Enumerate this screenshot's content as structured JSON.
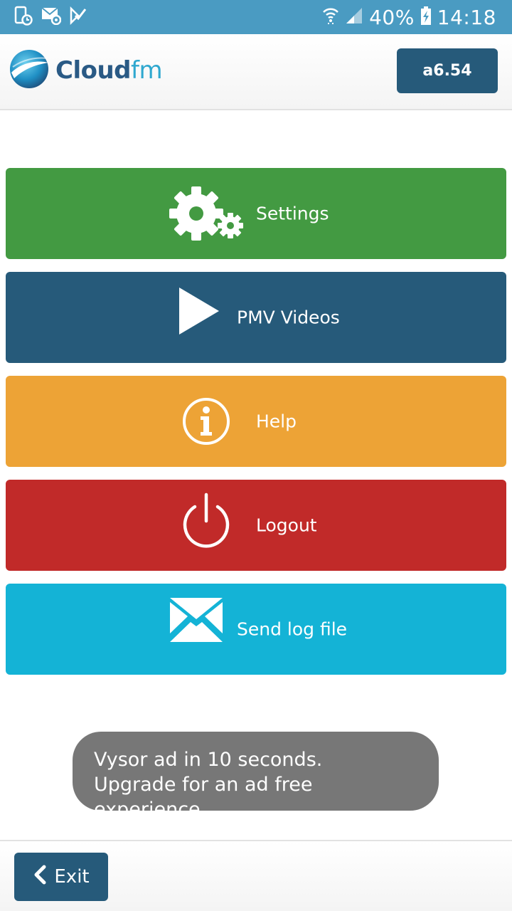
{
  "status_bar": {
    "battery": "40%",
    "time": "14:18",
    "icons": [
      "device-clock-icon",
      "mail-settings-icon",
      "checkmark-app-icon",
      "wifi-icon",
      "signal-icon",
      "battery-charging-icon"
    ]
  },
  "header": {
    "logo_cloud": "Cloud",
    "logo_fm": "fm",
    "version": "a6.54"
  },
  "menu": {
    "items": [
      {
        "label": "Settings",
        "icon": "gears-icon",
        "color": "#439a42"
      },
      {
        "label": "PMV Videos",
        "icon": "play-icon",
        "color": "#265a7a"
      },
      {
        "label": "Help",
        "icon": "info-icon",
        "color": "#eda336"
      },
      {
        "label": "Logout",
        "icon": "power-icon",
        "color": "#c12a29"
      },
      {
        "label": "Send log file",
        "icon": "envelope-icon",
        "color": "#14b3d6"
      }
    ]
  },
  "toast": {
    "line1": "Vysor ad in 10 seconds.",
    "line2": "Upgrade for an ad free experience."
  },
  "footer": {
    "exit_label": "Exit",
    "exit_icon": "chevron-left-icon"
  },
  "colors": {
    "status_bar": "#4a9bc2",
    "primary": "#265a7a",
    "toast": "#777777"
  }
}
